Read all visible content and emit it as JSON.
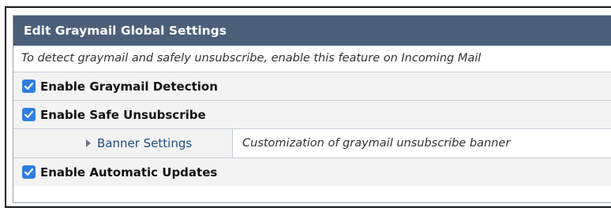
{
  "panel": {
    "title": "Edit Graymail Global Settings",
    "description": "To detect graymail and safely unsubscribe, enable this feature on Incoming Mail"
  },
  "settings": [
    {
      "label": "Enable Graymail Detection",
      "checked": true
    },
    {
      "label": "Enable Safe Unsubscribe",
      "checked": true
    },
    {
      "label": "Enable Automatic Updates",
      "checked": true
    }
  ],
  "banner": {
    "link_label": "Banner Settings",
    "description": "Customization of graymail unsubscribe banner"
  },
  "colors": {
    "header_bg": "#4b5f78",
    "checkbox": "#2f7de1",
    "link": "#1d4f7f"
  }
}
